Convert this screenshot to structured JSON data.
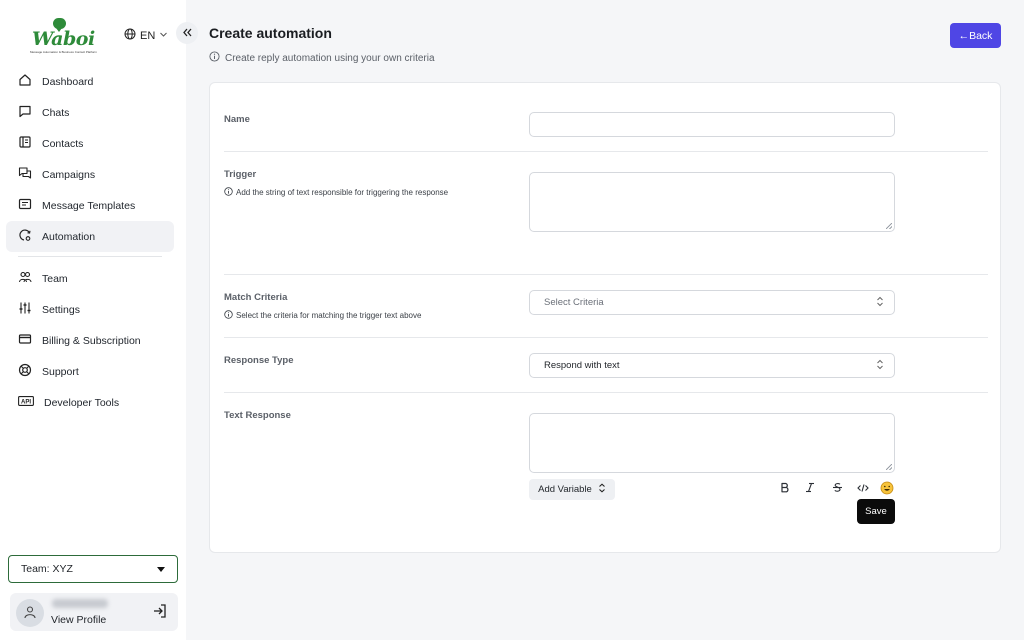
{
  "brand": {
    "name": "Waboi",
    "tagline": "Message Automation & Business Contact Platform",
    "color": "#2e8b3a"
  },
  "language": {
    "code": "EN"
  },
  "sidebar": {
    "items": [
      {
        "label": "Dashboard",
        "icon": "home-icon"
      },
      {
        "label": "Chats",
        "icon": "chat-icon"
      },
      {
        "label": "Contacts",
        "icon": "contacts-icon"
      },
      {
        "label": "Campaigns",
        "icon": "campaigns-icon"
      },
      {
        "label": "Message Templates",
        "icon": "template-icon"
      },
      {
        "label": "Automation",
        "icon": "automation-icon",
        "active": true
      },
      {
        "label": "Team",
        "icon": "team-icon"
      },
      {
        "label": "Settings",
        "icon": "settings-sliders-icon"
      },
      {
        "label": "Billing & Subscription",
        "icon": "credit-card-icon"
      },
      {
        "label": "Support",
        "icon": "lifebuoy-icon"
      },
      {
        "label": "Developer Tools",
        "icon": "api-icon"
      }
    ],
    "team": "Team: XYZ",
    "profile_link": "View Profile"
  },
  "header": {
    "title": "Create automation",
    "subtitle": "Create reply automation using your own criteria",
    "back_label": "←Back",
    "accent": "#4f46e5"
  },
  "form": {
    "name_label": "Name",
    "trigger_label": "Trigger",
    "trigger_help": "Add the string of text responsible for triggering the response",
    "match_label": "Match Criteria",
    "match_help": "Select the criteria for matching the trigger text above",
    "match_placeholder": "Select Criteria",
    "response_type_label": "Response Type",
    "response_type_value": "Respond with text",
    "text_response_label": "Text Response",
    "add_variable": "Add Variable",
    "save": "Save"
  }
}
